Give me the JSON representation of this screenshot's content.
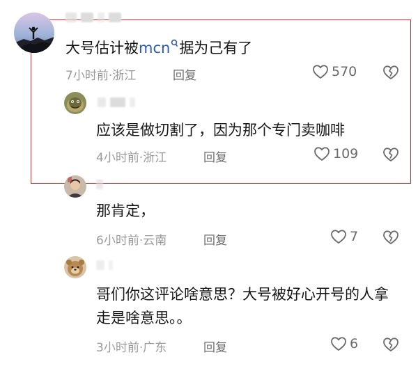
{
  "comments": [
    {
      "text_main": "大号估计被",
      "text_link": "mcn",
      "text_tail": "据为己有了",
      "time": "7小时前",
      "location": "浙江",
      "reply_label": "回复",
      "likes": "570"
    },
    {
      "text": "应该是做切割了，因为那个专门卖咖啡",
      "time": "4小时前",
      "location": "浙江",
      "reply_label": "回复",
      "likes": "109"
    },
    {
      "text": "那肯定，",
      "time": "6小时前",
      "location": "云南",
      "reply_label": "回复",
      "likes": "7"
    },
    {
      "text": "哥们你这评论啥意思？大号被好心开号的人拿走是啥意思。。",
      "time": "3小时前",
      "location": "广东",
      "reply_label": "回复",
      "likes": "6"
    }
  ],
  "separator": "·",
  "colors": {
    "highlight": "#c8312a",
    "link": "#2e5aa8",
    "meta": "#9a9a9a"
  },
  "icons": [
    "heart-icon",
    "broken-heart-icon",
    "search-icon"
  ]
}
